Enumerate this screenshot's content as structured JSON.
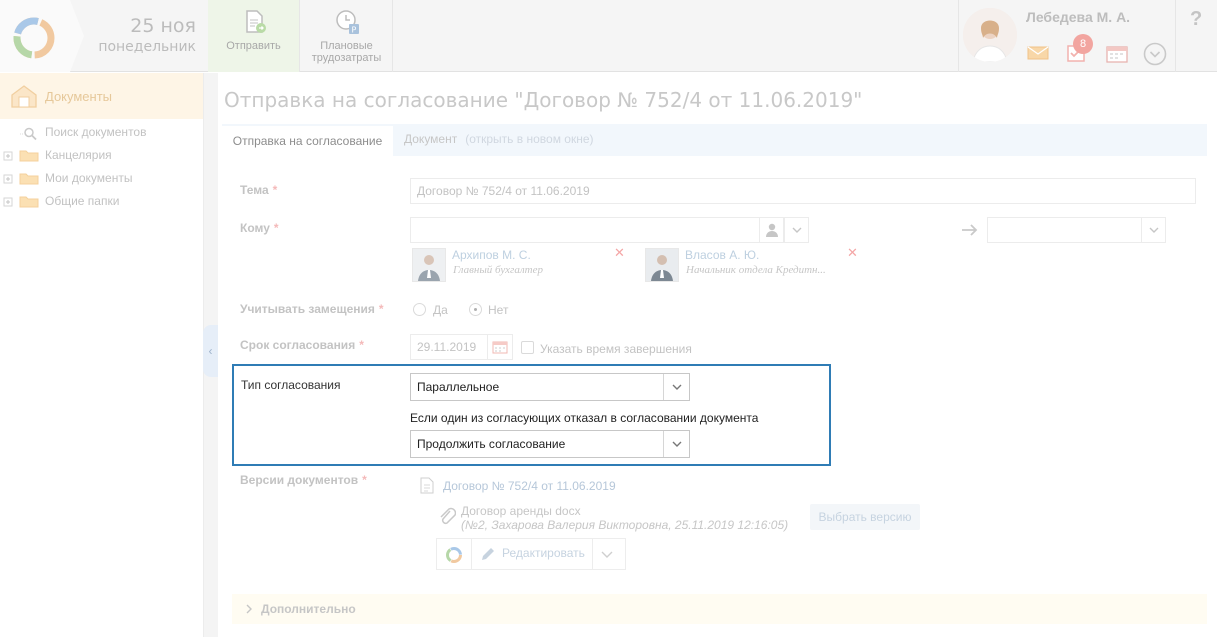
{
  "header": {
    "date_day": "25 ноя",
    "date_weekday": "понедельник",
    "send_label": "Отправить",
    "plan_label_line1": "Плановые",
    "plan_label_line2": "трудозатраты",
    "user_name": "Лебедева М. А.",
    "tasks_badge": "8",
    "help": "?"
  },
  "sidebar": {
    "title": "Документы",
    "items": [
      {
        "label": "Поиск документов",
        "icon": "search-icon"
      },
      {
        "label": "Канцелярия",
        "icon": "folder-icon"
      },
      {
        "label": "Мои документы",
        "icon": "folder-icon"
      },
      {
        "label": "Общие папки",
        "icon": "folder-icon"
      }
    ]
  },
  "page": {
    "title": "Отправка на согласование \"Договор № 752/4 от 11.06.2019\"",
    "tabs": [
      {
        "label": "Отправка на согласование"
      },
      {
        "label": "Документ",
        "sub": "(открыть в новом окне)"
      }
    ]
  },
  "form": {
    "subject_label": "Тема",
    "subject_value": "Договор № 752/4 от 11.06.2019",
    "to_label": "Кому",
    "recipients": [
      {
        "name": "Архипов М. С.",
        "position": "Главный бухгалтер"
      },
      {
        "name": "Власов А. Ю.",
        "position": "Начальник отдела Кредитн..."
      }
    ],
    "substitutions_label": "Учитывать замещения",
    "option_yes": "Да",
    "option_no": "Нет",
    "deadline_label": "Срок согласования",
    "deadline_value": "29.11.2019",
    "end_time_label": "Указать время завершения",
    "approval_type_label": "Тип согласования",
    "approval_type_value": "Параллельное",
    "reject_text": "Если один из согласующих отказал в согласовании документа",
    "reject_action_value": "Продолжить согласование",
    "versions_label": "Версии документов",
    "version_doc": "Договор № 752/4 от 11.06.2019",
    "attachment_name": "Договор аренды docx",
    "attachment_meta": "(№2, Захарова Валерия Викторовна, 25.11.2019 12:16:05)",
    "choose_version": "Выбрать версию",
    "edit_label": "Редактировать",
    "more_label": "Дополнительно"
  },
  "colors": {
    "highlight_border": "#2f7cb5",
    "required_star": "#f4b9b9",
    "badge": "#f2a5a0"
  }
}
